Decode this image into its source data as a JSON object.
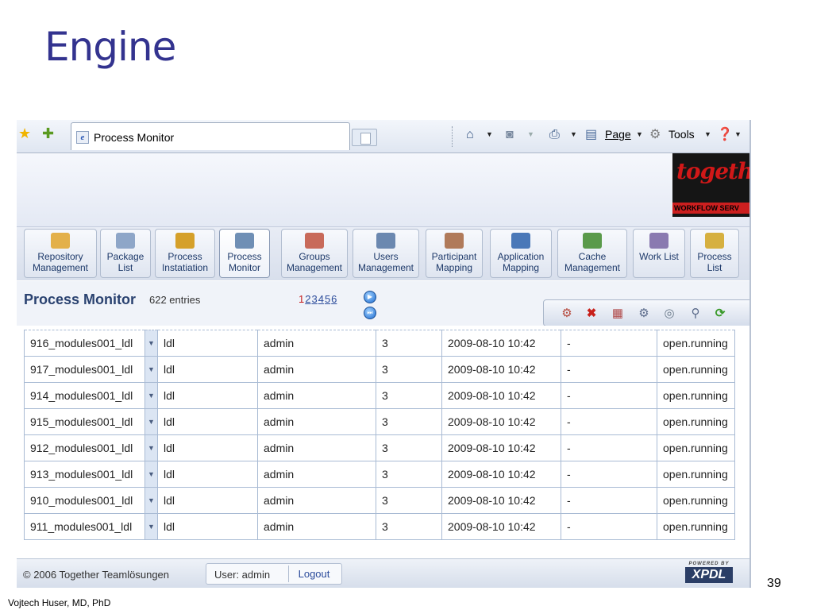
{
  "slide": {
    "title": "Engine",
    "number": "39",
    "footer": "Vojtech Huser, MD, PhD"
  },
  "browser": {
    "tab_title": "Process Monitor",
    "toolbar": {
      "page_label": "Page",
      "tools_label": "Tools",
      "icons": [
        "favorites-star-icon",
        "add-favorites-icon",
        "home-icon",
        "feeds-icon",
        "print-icon",
        "page-icon",
        "tools-gear-icon",
        "help-icon"
      ]
    }
  },
  "app": {
    "logo_script": "together",
    "logo_tag": "WORKFLOW SERV",
    "modules": [
      {
        "label": "Repository Management",
        "icon": "repository-icon",
        "color": "#e3b04a"
      },
      {
        "label": "Package List",
        "icon": "package-list-icon",
        "color": "#8ea6c8"
      },
      {
        "label": "Process Instatiation",
        "icon": "gears-icon",
        "color": "#d5a02a"
      },
      {
        "label": "Process Monitor",
        "icon": "monitor-icon",
        "color": "#6f8fb5",
        "active": true
      },
      {
        "label": "Groups Management",
        "icon": "groups-icon",
        "color": "#c86a5a"
      },
      {
        "label": "Users Management",
        "icon": "user-icon",
        "color": "#6b88b0"
      },
      {
        "label": "Participant Mapping",
        "icon": "participant-icon",
        "color": "#b07a5a"
      },
      {
        "label": "Application Mapping",
        "icon": "application-icon",
        "color": "#4a78b8"
      },
      {
        "label": "Cache Management",
        "icon": "cache-icon",
        "color": "#5a9a4a"
      },
      {
        "label": "Work List",
        "icon": "worklist-icon",
        "color": "#8a7ab0"
      },
      {
        "label": "Process List",
        "icon": "process-list-icon",
        "color": "#d6b040"
      }
    ],
    "monitor": {
      "title": "Process Monitor",
      "entries": "622 entries",
      "pages": [
        "1",
        "2",
        "3",
        "4",
        "5",
        "6"
      ],
      "current_page": "1",
      "actions": [
        "delete-instance-icon",
        "terminate-icon",
        "grid-icon",
        "variables-icon",
        "activities-icon",
        "search-icon",
        "refresh-icon"
      ]
    },
    "rows": [
      {
        "id": "916_modules001_ldl",
        "package": "ldl",
        "user": "admin",
        "version": "3",
        "created": "2009-08-10 10:42",
        "finished": "-",
        "state": "open.running"
      },
      {
        "id": "917_modules001_ldl",
        "package": "ldl",
        "user": "admin",
        "version": "3",
        "created": "2009-08-10 10:42",
        "finished": "-",
        "state": "open.running"
      },
      {
        "id": "914_modules001_ldl",
        "package": "ldl",
        "user": "admin",
        "version": "3",
        "created": "2009-08-10 10:42",
        "finished": "-",
        "state": "open.running"
      },
      {
        "id": "915_modules001_ldl",
        "package": "ldl",
        "user": "admin",
        "version": "3",
        "created": "2009-08-10 10:42",
        "finished": "-",
        "state": "open.running"
      },
      {
        "id": "912_modules001_ldl",
        "package": "ldl",
        "user": "admin",
        "version": "3",
        "created": "2009-08-10 10:42",
        "finished": "-",
        "state": "open.running"
      },
      {
        "id": "913_modules001_ldl",
        "package": "ldl",
        "user": "admin",
        "version": "3",
        "created": "2009-08-10 10:42",
        "finished": "-",
        "state": "open.running"
      },
      {
        "id": "910_modules001_ldl",
        "package": "ldl",
        "user": "admin",
        "version": "3",
        "created": "2009-08-10 10:42",
        "finished": "-",
        "state": "open.running"
      },
      {
        "id": "911_modules001_ldl",
        "package": "ldl",
        "user": "admin",
        "version": "3",
        "created": "2009-08-10 10:42",
        "finished": "-",
        "state": "open.running"
      }
    ],
    "footer": {
      "copyright": "© 2006 Together Teamlösungen",
      "user": "User: admin",
      "logout": "Logout",
      "powered_by": "POWERED BY",
      "xpdl": "XPDL"
    }
  }
}
